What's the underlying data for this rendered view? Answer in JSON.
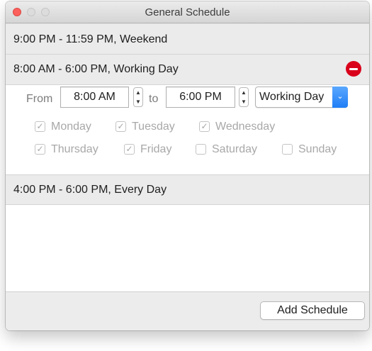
{
  "window": {
    "title": "General Schedule"
  },
  "schedules": [
    {
      "label": "9:00 PM - 11:59 PM, Weekend"
    },
    {
      "label": "8:00 AM - 6:00 PM, Working Day"
    },
    {
      "label": "4:00 PM - 6:00 PM, Every Day"
    }
  ],
  "editor": {
    "from_label": "From",
    "to_label": "to",
    "from_time": "8:00 AM",
    "to_time": "6:00 PM",
    "day_type": "Working Day",
    "days": [
      {
        "name": "Monday",
        "checked": true
      },
      {
        "name": "Tuesday",
        "checked": true
      },
      {
        "name": "Wednesday",
        "checked": true
      },
      {
        "name": "Thursday",
        "checked": true
      },
      {
        "name": "Friday",
        "checked": true
      },
      {
        "name": "Saturday",
        "checked": false
      },
      {
        "name": "Sunday",
        "checked": false
      }
    ]
  },
  "footer": {
    "add_button": "Add Schedule"
  },
  "icons": {
    "close": "close-dot-icon",
    "minimize": "minimize-dot-icon",
    "zoom": "zoom-dot-icon",
    "remove": "remove-circle-icon",
    "stepper": "up-down-stepper-icon",
    "popup_arrow": "chevron-down-icon",
    "checkmark": "checkmark-icon"
  },
  "colors": {
    "close_dot": "#fc605c",
    "remove_button": "#d9001b",
    "accent": "#1f7ef5"
  }
}
